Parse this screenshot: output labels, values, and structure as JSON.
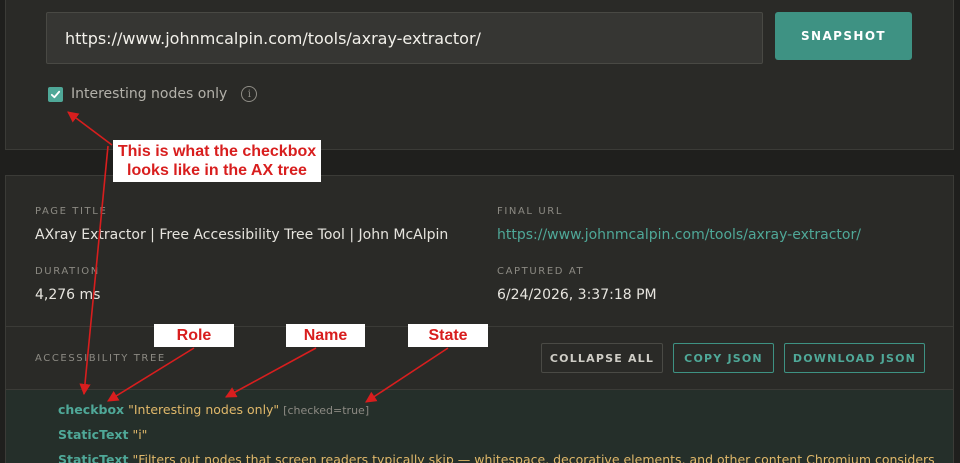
{
  "snapshot_form": {
    "url_value": "https://www.johnmcalpin.com/tools/axray-extractor/",
    "snapshot_label": "SNAPSHOT",
    "interesting_nodes_label": "Interesting nodes only",
    "interesting_nodes_checked": true,
    "info_glyph": "i"
  },
  "results": {
    "page_title_label": "PAGE TITLE",
    "page_title_value": "AXray Extractor | Free Accessibility Tree Tool | John McAlpin",
    "final_url_label": "FINAL URL",
    "final_url_value": "https://www.johnmcalpin.com/tools/axray-extractor/",
    "duration_label": "DURATION",
    "duration_value": "4,276 ms",
    "captured_at_label": "CAPTURED AT",
    "captured_at_value": "6/24/2026, 3:37:18 PM",
    "accent_color": "#4fa898"
  },
  "tree": {
    "heading": "ACCESSIBILITY TREE",
    "collapse_all_label": "COLLAPSE ALL",
    "copy_json_label": "COPY JSON",
    "download_json_label": "DOWNLOAD JSON",
    "nodes": [
      {
        "role": "checkbox",
        "name": "\"Interesting nodes only\"",
        "state": "[checked=true]"
      },
      {
        "role": "StaticText",
        "name": "\"i\"",
        "state": ""
      },
      {
        "role": "StaticText",
        "name": "\"Filters out nodes that screen readers typically skip — whitespace, decorative elements, and other content Chromium considers",
        "state": ""
      }
    ]
  },
  "annotations": {
    "checkbox_note_line1": "This is what the checkbox",
    "checkbox_note_line2": "looks like in the AX tree",
    "role_label": "Role",
    "name_label": "Name",
    "state_label": "State",
    "annotation_color": "#d81e1e"
  }
}
